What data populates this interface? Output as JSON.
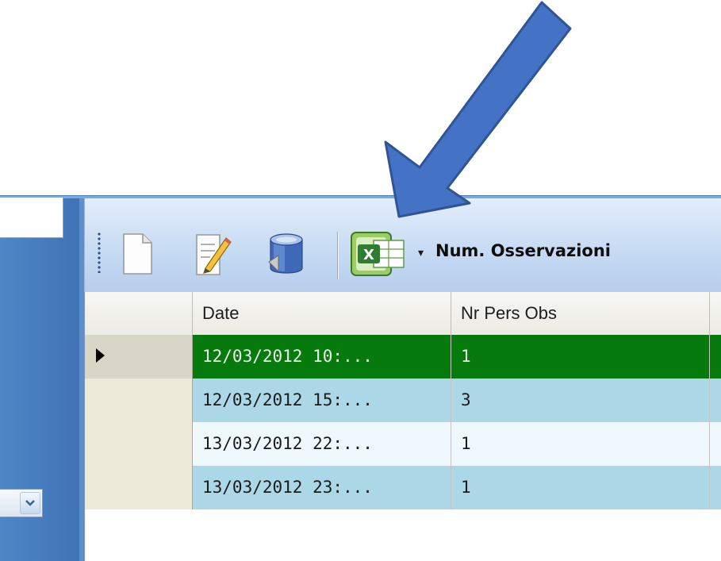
{
  "toolbar": {
    "buttons": [
      {
        "name": "new-document-icon"
      },
      {
        "name": "edit-document-icon"
      },
      {
        "name": "database-icon"
      },
      {
        "name": "excel-export-icon"
      }
    ],
    "dropdown_arrow": "▾",
    "label": "Num. Osservazioni"
  },
  "grid": {
    "columns": [
      "Date",
      "Nr Pers Obs"
    ],
    "rows": [
      {
        "date": "12/03/2012 10:...",
        "nr": "1",
        "extra": "(",
        "state": "selected"
      },
      {
        "date": "12/03/2012 15:...",
        "nr": "3",
        "extra": "",
        "state": "alt"
      },
      {
        "date": "13/03/2012 22:...",
        "nr": "1",
        "extra": "I",
        "state": "normal"
      },
      {
        "date": "13/03/2012 23:...",
        "nr": "1",
        "extra": "I",
        "state": "alt"
      }
    ]
  },
  "left_panel": {
    "dropdown_icon": "chevron-down-icon"
  },
  "colors": {
    "annotation_arrow": "#4472c4",
    "selected_row": "#067a0d",
    "alt_row": "#acd7e6"
  }
}
